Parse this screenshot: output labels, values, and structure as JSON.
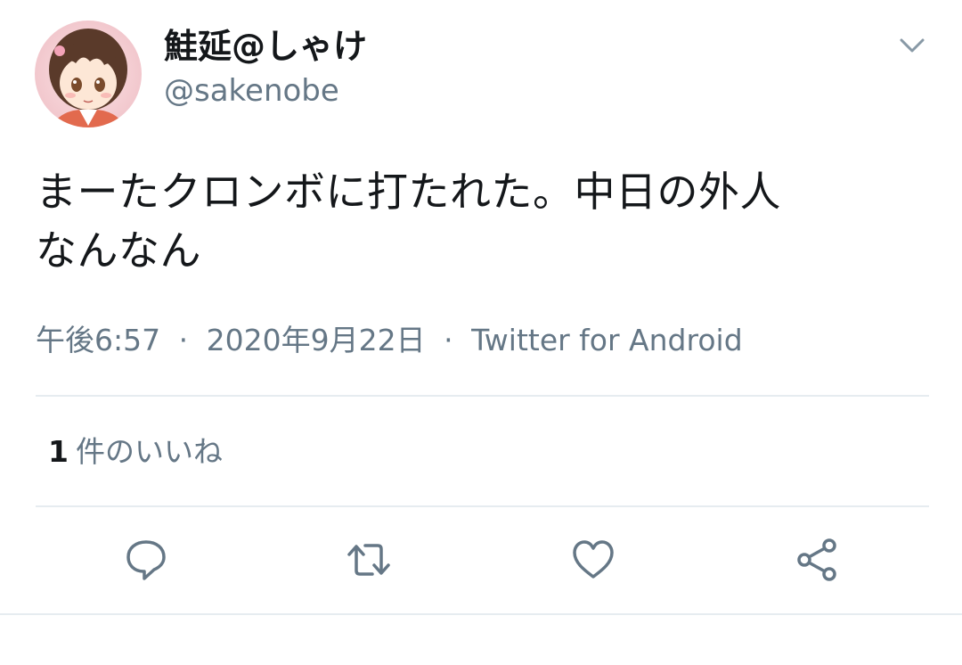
{
  "user": {
    "display_name": "鮭延@しゃけ",
    "handle": "@sakenobe"
  },
  "tweet": {
    "text_line1": "まーたクロンボに打たれた。中日の外人",
    "text_line2": "なんなん",
    "time": "午後6:57",
    "date": "2020年9月22日",
    "separator": "·",
    "source": "Twitter for Android"
  },
  "stats": {
    "like_count": "1",
    "like_label": "件のいいね"
  },
  "icons": {
    "menu": "chevron-down-icon",
    "reply": "reply-bubble-icon",
    "retweet": "retweet-icon",
    "like": "heart-icon",
    "share": "share-icon"
  },
  "colors": {
    "text_primary": "#14171a",
    "text_secondary": "#657786",
    "divider": "#e6ecf0"
  }
}
